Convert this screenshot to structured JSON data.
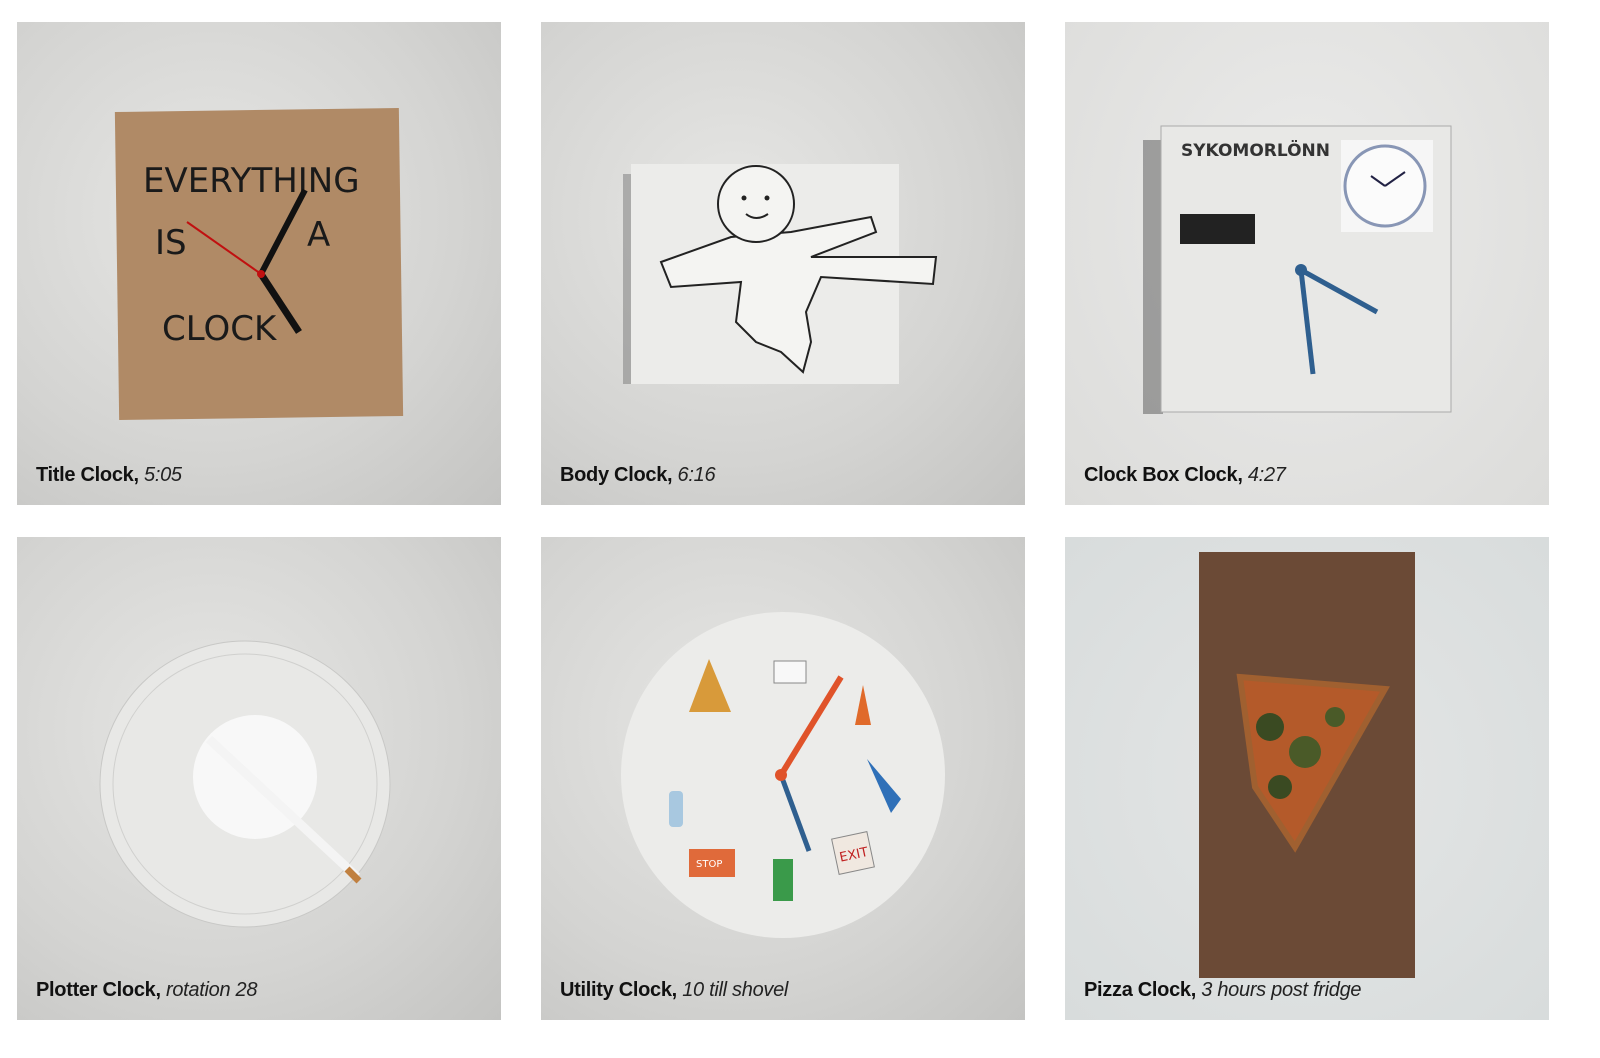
{
  "gallery": {
    "items": [
      {
        "title": "Title Clock,",
        "subtitle": "5:05",
        "artwork_lettering": "EVERYTHING IS A CLOCK"
      },
      {
        "title": "Body Clock,",
        "subtitle": "6:16"
      },
      {
        "title": "Clock Box Clock,",
        "subtitle": "4:27",
        "artwork_lettering": "SYKOMORLÖNN"
      },
      {
        "title": "Plotter Clock,",
        "subtitle": "rotation 28"
      },
      {
        "title": "Utility Clock,",
        "subtitle": "10 till shovel",
        "artwork_lettering": "STOP EXIT"
      },
      {
        "title": "Pizza Clock,",
        "subtitle": "3 hours post fridge"
      }
    ]
  },
  "colors": {
    "cardboard": "#b08a66",
    "wood": "#6b4a36",
    "hand_red": "#e0532a",
    "hand_blue": "#2f5f8f"
  }
}
